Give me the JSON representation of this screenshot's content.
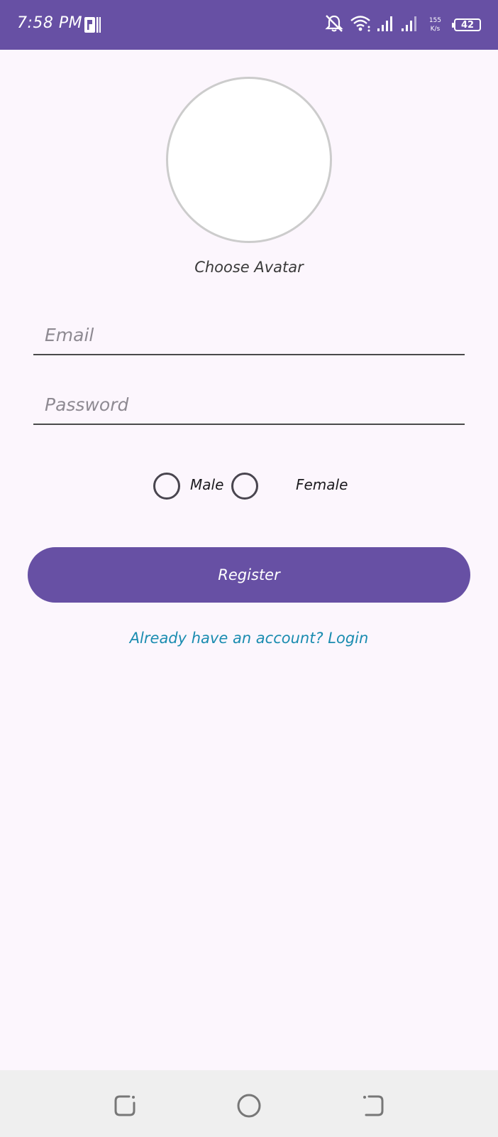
{
  "status_bar": {
    "time": "7:58 PM",
    "speed_value": "155",
    "speed_unit": "K/s",
    "battery": "42"
  },
  "avatar": {
    "label": "Choose Avatar"
  },
  "form": {
    "email_placeholder": "Email",
    "email_value": "",
    "password_placeholder": "Password",
    "password_value": ""
  },
  "gender": {
    "options": [
      "Male",
      "Female"
    ],
    "selected": ""
  },
  "register_label": "Register",
  "login_link": "Already have an account? Login",
  "colors": {
    "primary": "#6750a4",
    "background": "#fcf6fd",
    "link": "#1a8cb0"
  },
  "icons": {
    "status_app": "app-notification-icon",
    "status_dnd": "bell-off-icon",
    "status_wifi": "wifi-icon",
    "status_signal_1": "signal-icon",
    "status_signal_2": "signal-icon",
    "nav_recents": "recents-icon",
    "nav_home": "home-icon",
    "nav_back": "back-icon"
  }
}
